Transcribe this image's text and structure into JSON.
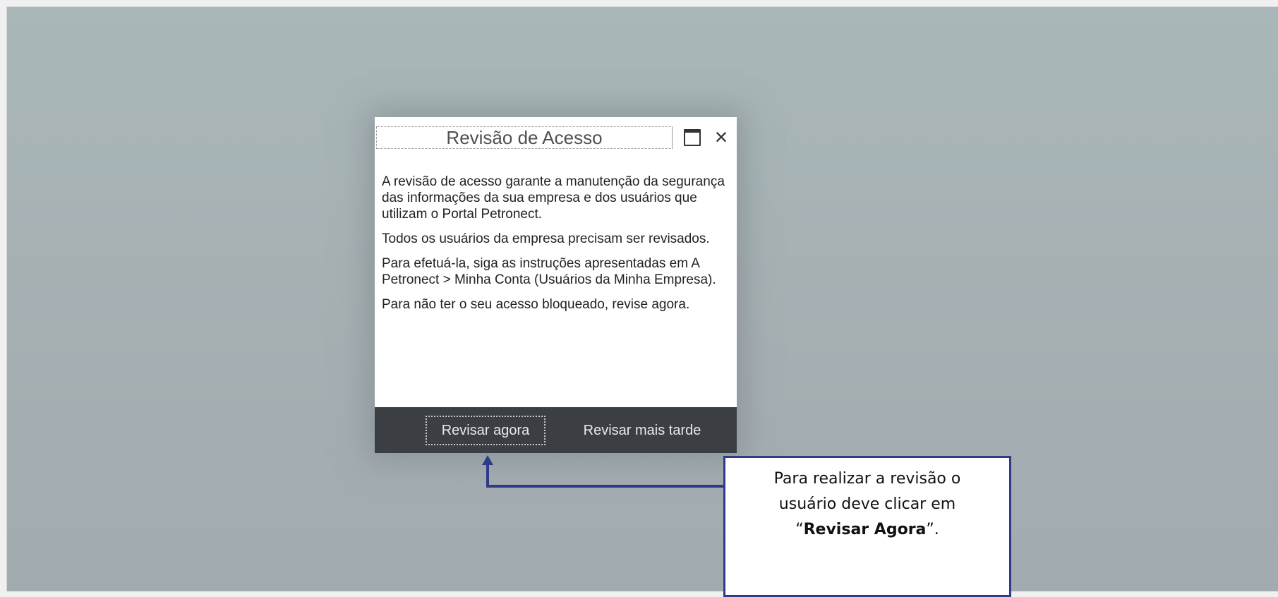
{
  "dialog": {
    "title": "Revisão de Acesso",
    "maximize_icon": "maximize-icon",
    "close_icon": "close-icon",
    "close_glyph": "×",
    "paragraphs": [
      "A revisão de acesso garante a manutenção da segurança das informações da sua empresa e dos usuários que utilizam o Portal Petronect.",
      "Todos os usuários da empresa precisam ser revisados.",
      "Para efetuá-la, siga as instruções apresentadas em A Petronect > Minha Conta (Usuários da Minha Empresa).",
      "Para não ter o seu acesso bloqueado, revise agora."
    ],
    "buttons": {
      "review_now": "Revisar agora",
      "review_later": "Revisar mais tarde"
    }
  },
  "callout": {
    "line1": "Para realizar a revisão o",
    "line2": "usuário deve clicar em",
    "quote_open": "“",
    "highlight": "Revisar Agora",
    "quote_close": "”."
  },
  "colors": {
    "backdrop": "#a6b1b4",
    "footer": "#3b3f43",
    "callout_border": "#2f3b88"
  }
}
